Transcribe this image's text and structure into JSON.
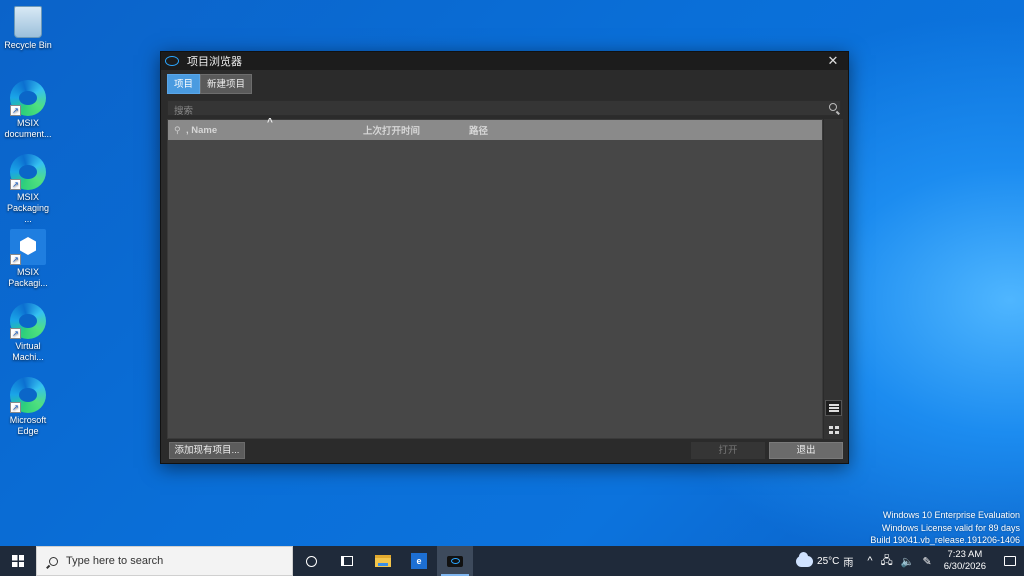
{
  "desktop": {
    "icons": [
      {
        "label": "Recycle Bin"
      },
      {
        "label": "MSIX document..."
      },
      {
        "label": "MSIX Packaging ..."
      },
      {
        "label": "MSIX Packagi..."
      },
      {
        "label": "Virtual Machi..."
      },
      {
        "label": "Microsoft Edge"
      }
    ]
  },
  "window": {
    "title": "项目浏览器",
    "close_glyph": "✕",
    "tabs": [
      {
        "label": "项目",
        "active": true
      },
      {
        "label": "新建项目",
        "active": false
      }
    ],
    "search_placeholder": "搜索",
    "columns": {
      "name": ", Name",
      "last_opened": "上次打开时间",
      "path": "路径"
    },
    "sort_arrow": "^",
    "buttons": {
      "add_existing": "添加现有项目...",
      "open": "打开",
      "exit": "退出"
    }
  },
  "watermark": {
    "line1": "Windows 10 Enterprise Evaluation",
    "line2": "Windows License valid for 89 days",
    "line3": "Build 19041.vb_release.191206-1406"
  },
  "taskbar": {
    "search_placeholder": "Type here to search",
    "store_glyph": "e",
    "weather_temp": "25°C",
    "weather_desc": "雨",
    "tray_chevron": "^",
    "time": "7:23 AM",
    "date": "6/30/2026"
  }
}
